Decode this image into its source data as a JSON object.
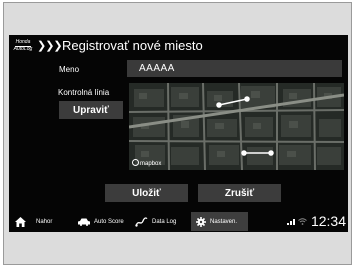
{
  "header": {
    "logo_text": "Honda",
    "logo_sub": "AutoLog",
    "chevrons": "❯❯❯",
    "title": "Registrovať nové miesto"
  },
  "form": {
    "name_label": "Meno",
    "name_value": "AAAAA",
    "checkpoint_label": "Kontrolná línia",
    "edit_button": "Upraviť",
    "map_attribution": "mapbox"
  },
  "actions": {
    "save": "Uložiť",
    "cancel": "Zrušiť"
  },
  "nav": {
    "items": [
      {
        "label": "Nahor",
        "icon": "home-icon"
      },
      {
        "label": "Auto Score",
        "icon": "car-icon"
      },
      {
        "label": "Data Log",
        "icon": "route-icon"
      },
      {
        "label": "Nastaven.",
        "icon": "gear-icon",
        "active": true
      }
    ]
  },
  "status": {
    "clock": "12:34",
    "icons": [
      "signal-icon",
      "wifi-icon"
    ]
  },
  "colors": {
    "screen_bg": "#050505",
    "button_bg": "#3c3c3c",
    "field_bg": "#3a3a3a",
    "text": "#ffffff"
  }
}
